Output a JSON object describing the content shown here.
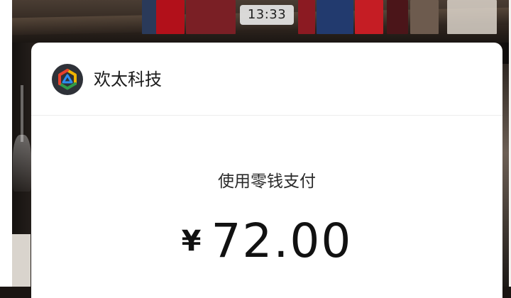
{
  "status_bar": {
    "time": "13:33"
  },
  "merchant": {
    "name": "欢太科技",
    "logo_icon": "heytap-hexagon-logo"
  },
  "payment": {
    "method_label": "使用零钱支付",
    "currency_symbol": "¥",
    "amount": "72.00"
  },
  "colors": {
    "sheet_bg": "#ffffff",
    "logo_bg": "#2e3138",
    "logo_accents": [
      "#f0b400",
      "#2f9b49",
      "#e8412b",
      "#2b8ef0"
    ]
  }
}
